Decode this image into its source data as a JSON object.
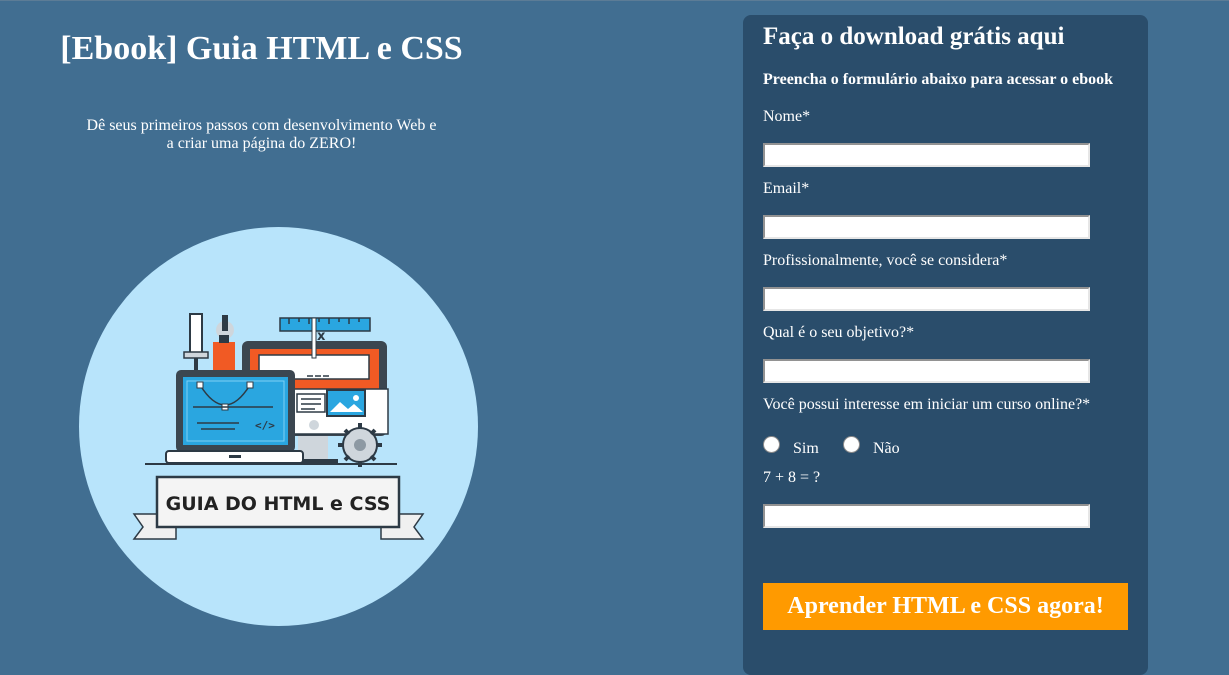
{
  "hero": {
    "title": "[Ebook] Guia HTML e CSS",
    "subtitle_line1": "Dê seus primeiros passos com desenvolvimento Web e",
    "subtitle_line2": "a criar uma página do ZERO!",
    "image_banner_text": "GUIA DO HTML e CSS",
    "illustration_code_glyph": "</>",
    "illustration_close_glyph": "x",
    "colors": {
      "circle": "#b8e4fb",
      "orange": "#f15a24",
      "blue": "#2aa6e0",
      "dark": "#2d3a45"
    }
  },
  "form": {
    "title": "Faça o download grátis aqui",
    "subtitle": "Preencha o formulário abaixo para acessar o ebook",
    "fields": {
      "nome": {
        "label": "Nome*",
        "value": ""
      },
      "email": {
        "label": "Email*",
        "value": ""
      },
      "profissao": {
        "label": "Profissionalmente, você se considera*",
        "value": ""
      },
      "objetivo": {
        "label": "Qual é o seu objetivo?*",
        "value": ""
      },
      "interesse": {
        "label": "Você possui interesse em iniciar um curso online?*",
        "options": [
          "Sim",
          "Não"
        ]
      },
      "captcha": {
        "label": "7 + 8 = ?",
        "value": ""
      }
    },
    "submit_label": "Aprender HTML e CSS agora!",
    "colors": {
      "background": "#416e91",
      "card": "#2a4d6b",
      "button": "#ff9a00"
    }
  }
}
